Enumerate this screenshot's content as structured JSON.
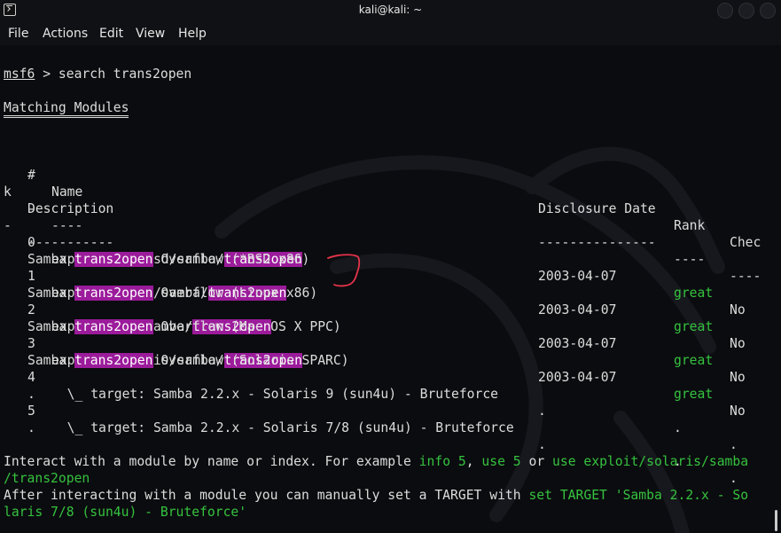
{
  "window": {
    "title": "kali@kali: ~"
  },
  "menu": [
    "File",
    "Actions",
    "Edit",
    "View",
    "Help"
  ],
  "icons": {
    "app": "terminal-icon",
    "minimize": "minimize-icon",
    "maximize": "maximize-icon",
    "close": "close-icon",
    "watermark": "kali-dragon-logo"
  },
  "colors": {
    "background": "#0b0c0f",
    "text": "#dcdcdc",
    "highlight": "#9b1b9b",
    "green": "#35c23f",
    "annotation": "#e5334a"
  },
  "terminal": {
    "prompt": "msf6",
    "prompt_sep": " > ",
    "command": "search trans2open",
    "section_title": "Matching Modules",
    "header": {
      "num": "#",
      "name": "Name",
      "date": "Disclosure Date",
      "rank": "Rank",
      "check_a": "Chec",
      "check_b": "k",
      "description": "Description"
    },
    "header_rule": {
      "num": "-",
      "name": "----",
      "date": "---------------",
      "rank": "----",
      "check": "----",
      "wrap": "-",
      "description": "-----------"
    },
    "highlight_term": "trans2open",
    "modules": [
      {
        "index": "0",
        "path": "exploit/freebsd/samba/",
        "date": "2003-04-07",
        "rank": "great",
        "check": "No",
        "desc_prefix": "Samba ",
        "desc_suffix": " Overflow (*BSD x86)"
      },
      {
        "index": "1",
        "path": "exploit/linux/samba/",
        "date": "2003-04-07",
        "rank": "great",
        "check": "No",
        "desc_prefix": "Samba ",
        "desc_suffix": " Overflow (Linux x86)"
      },
      {
        "index": "2",
        "path": "exploit/osx/samba/",
        "date": "2003-04-07",
        "rank": "great",
        "check": "No",
        "desc_prefix": "Samba ",
        "desc_suffix": " Overflow (Mac OS X PPC)"
      },
      {
        "index": "3",
        "path": "exploit/solaris/samba/",
        "date": "2003-04-07",
        "rank": "great",
        "check": "No",
        "desc_prefix": "Samba ",
        "desc_suffix": " Overflow (Solaris SPARC)"
      }
    ],
    "targets": [
      {
        "index": "4",
        "text": "  \\_ target: Samba 2.2.x - Solaris 9 (sun4u) - Bruteforce",
        "date": ".",
        "rank": ".",
        "check": ".",
        "wrap": "."
      },
      {
        "index": "5",
        "text": "  \\_ target: Samba 2.2.x - Solaris 7/8 (sun4u) - Bruteforce",
        "date": ".",
        "rank": ".",
        "check": ".",
        "wrap": "."
      }
    ],
    "footer": {
      "line1_pre": "Interact with a module by name or index. For example ",
      "info": "info 5",
      "comma": ", ",
      "use": "use 5",
      "or": " or ",
      "use_full_a": "use exploit/solaris/samba",
      "use_full_b": "/trans2open",
      "line3_pre": "After interacting with a module you can manually set a TARGET with ",
      "set_a": "set TARGET 'Samba 2.2.x - So",
      "set_b": "laris 7/8 (sun4u) - Bruteforce'"
    }
  }
}
